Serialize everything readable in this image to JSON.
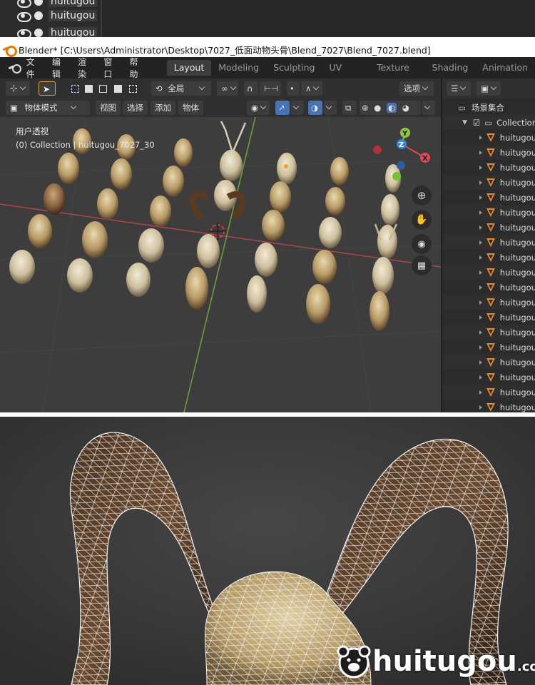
{
  "top_outliner": {
    "items": [
      {
        "label": "huitugou"
      },
      {
        "label": "huitugou"
      },
      {
        "label": "huitugou"
      }
    ]
  },
  "titlebar": {
    "title": "Blender* [C:\\Users\\Administrator\\Desktop\\7027_低面动物头骨\\Blend_7027\\Blend_7027.blend]"
  },
  "menubar": {
    "menus": [
      "文件",
      "编辑",
      "渲染",
      "窗口",
      "帮助"
    ],
    "workspaces": [
      "Layout",
      "Modeling",
      "Sculpting",
      "UV Editing",
      "Texture Paint",
      "Shading",
      "Animation"
    ],
    "active_workspace": "Layout"
  },
  "header": {
    "transform_orientation": "全局",
    "options_label": "选项",
    "mode_label": "物体模式",
    "menus": [
      "视图",
      "选择",
      "添加",
      "物体"
    ]
  },
  "viewport": {
    "view_name": "用户透视",
    "active_object": "(0) Collection | huitugou_7027_30",
    "gizmo_axes": {
      "x": "X",
      "y": "Y",
      "z": "Z"
    },
    "colors": {
      "x_axis": "#e04858",
      "y_axis": "#8cc641",
      "z_axis": "#3b84d8",
      "grid_bg": "#3d3d3d"
    }
  },
  "outliner": {
    "scene_collection": "场景集合",
    "collection": "Collection",
    "objects": [
      "huitugou",
      "huitugou",
      "huitugou",
      "huitugou",
      "huitugou",
      "huitugou",
      "huitugou",
      "huitugou",
      "huitugou",
      "huitugou",
      "huitugou",
      "huitugou",
      "huitugou",
      "huitugou",
      "huitugou",
      "huitugou",
      "huitugou",
      "huitugou",
      "huitugou"
    ]
  },
  "watermark": {
    "text": "huitugou",
    "domain": ".com"
  }
}
